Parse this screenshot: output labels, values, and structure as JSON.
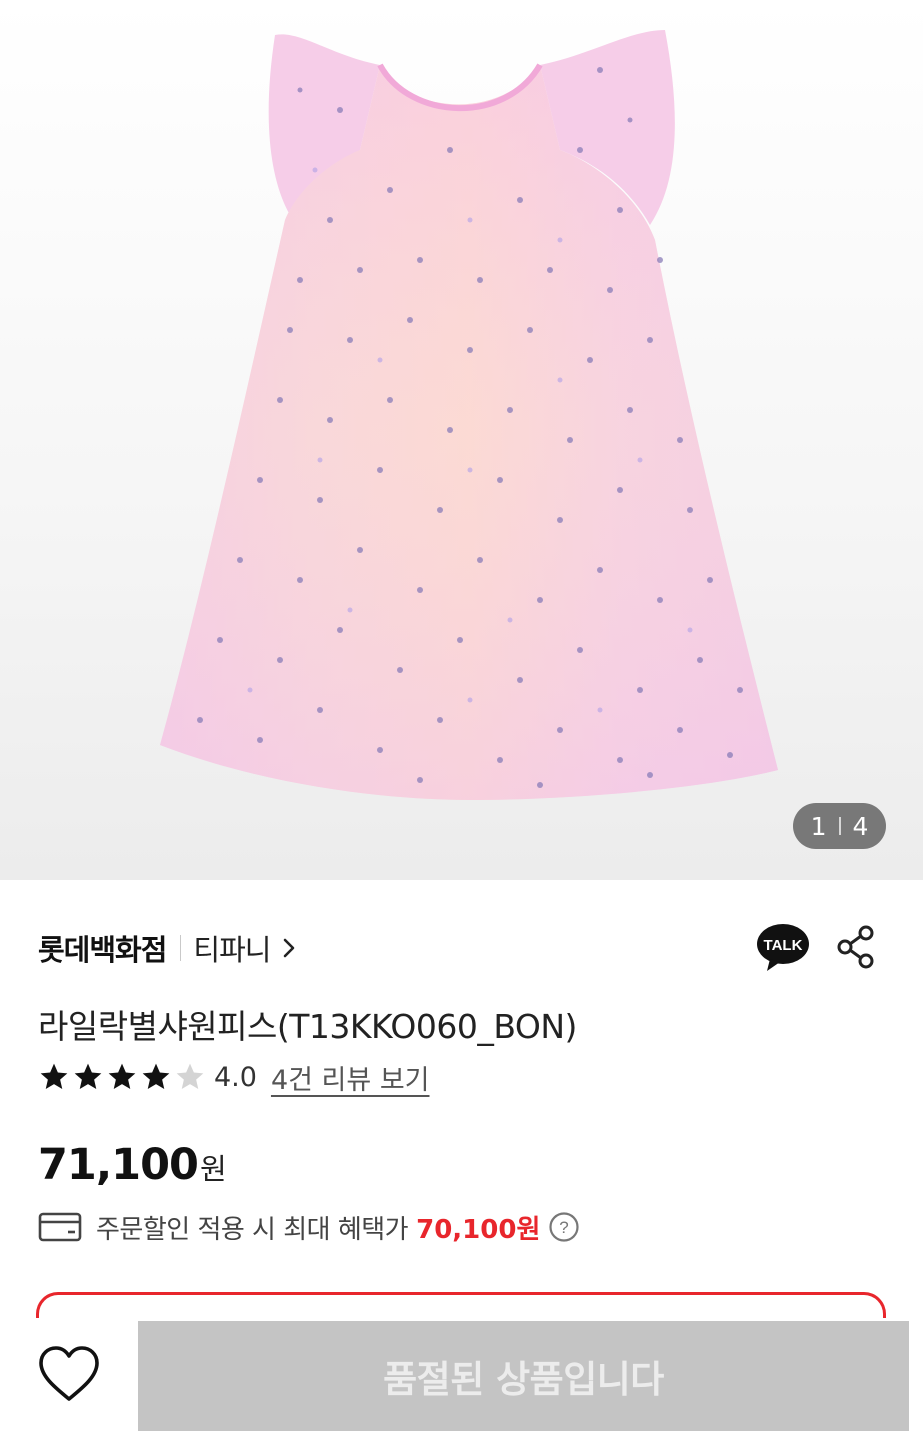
{
  "gallery": {
    "image_alt": "라일락별샤원피스",
    "current": "1",
    "total": "4"
  },
  "brand": {
    "store": "롯데백화점",
    "name": "티파니"
  },
  "product": {
    "title": "라일락별샤원피스(T13KKO060_BON)",
    "rating": "4.0",
    "rating_value": 4,
    "rating_max": 5,
    "review_link": "4건 리뷰 보기"
  },
  "price": {
    "amount": "71,100",
    "currency": "원"
  },
  "benefit": {
    "text": "주문할인 적용 시 최대 혜택가",
    "price": "70,100원"
  },
  "actions": {
    "talk_label": "TALK",
    "soldout_label": "품절된 상품입니다"
  },
  "colors": {
    "accent": "#e8262c",
    "disabled": "#c4c4c4"
  }
}
